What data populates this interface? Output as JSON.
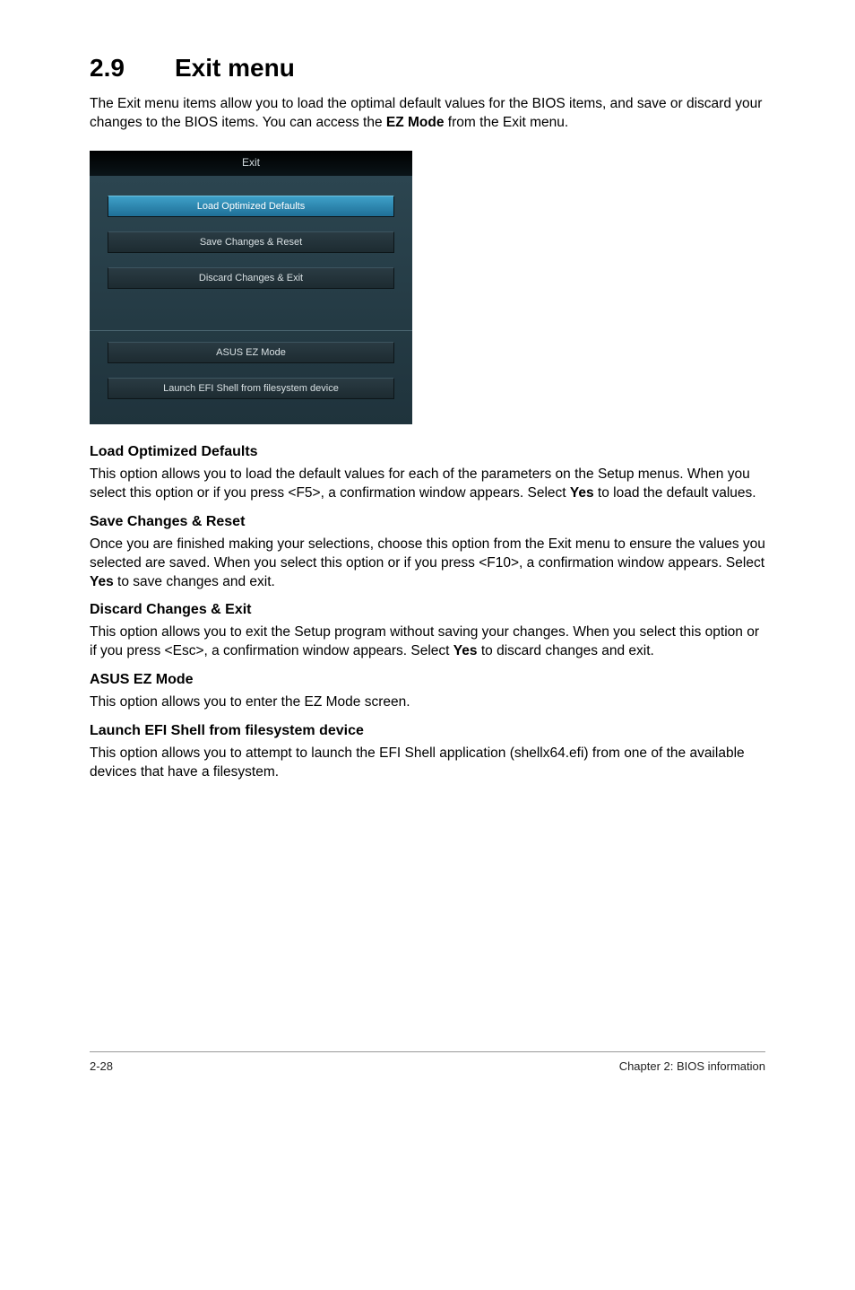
{
  "heading": {
    "number": "2.9",
    "title": "Exit menu"
  },
  "intro_parts": {
    "p1": "The Exit menu items allow you to load the optimal default values for the BIOS items, and save or discard your changes to the BIOS items. You can access the ",
    "bold": "EZ Mode",
    "p2": " from the Exit menu."
  },
  "bios": {
    "header": "Exit",
    "items": [
      {
        "label": "Load Optimized Defaults",
        "highlight": true
      },
      {
        "label": "Save Changes & Reset",
        "highlight": false
      },
      {
        "label": "Discard Changes & Exit",
        "highlight": false
      }
    ],
    "items2": [
      {
        "label": "ASUS EZ Mode"
      },
      {
        "label": "Launch EFI Shell from filesystem device"
      }
    ]
  },
  "sections": [
    {
      "title": "Load Optimized Defaults",
      "body_parts": [
        {
          "t": "text",
          "v": "This option allows you to load the default values for each of the parameters on the Setup menus. When you select this option or if you press <F5>, a confirmation window appears. Select "
        },
        {
          "t": "bold",
          "v": "Yes"
        },
        {
          "t": "text",
          "v": " to load the default values."
        }
      ]
    },
    {
      "title": "Save Changes & Reset",
      "body_parts": [
        {
          "t": "text",
          "v": "Once you are finished making your selections, choose this option from the Exit menu to ensure the values you selected are saved. When you select this option or if you press <F10>, a confirmation window appears. Select "
        },
        {
          "t": "bold",
          "v": "Yes"
        },
        {
          "t": "text",
          "v": " to save changes and exit."
        }
      ]
    },
    {
      "title": "Discard Changes & Exit",
      "body_parts": [
        {
          "t": "text",
          "v": "This option allows you to exit the Setup program without saving your changes. When you select this option or if you press <Esc>, a confirmation window appears. Select "
        },
        {
          "t": "bold",
          "v": "Yes"
        },
        {
          "t": "text",
          "v": " to discard changes and exit."
        }
      ]
    },
    {
      "title": "ASUS EZ Mode",
      "body_parts": [
        {
          "t": "text",
          "v": "This option allows you to enter the EZ Mode screen."
        }
      ]
    },
    {
      "title": "Launch EFI Shell from filesystem device",
      "body_parts": [
        {
          "t": "text",
          "v": "This option allows you to attempt to launch the EFI Shell application (shellx64.efi) from one of the available devices that have a filesystem."
        }
      ]
    }
  ],
  "footer": {
    "left": "2-28",
    "right": "Chapter 2: BIOS information"
  }
}
